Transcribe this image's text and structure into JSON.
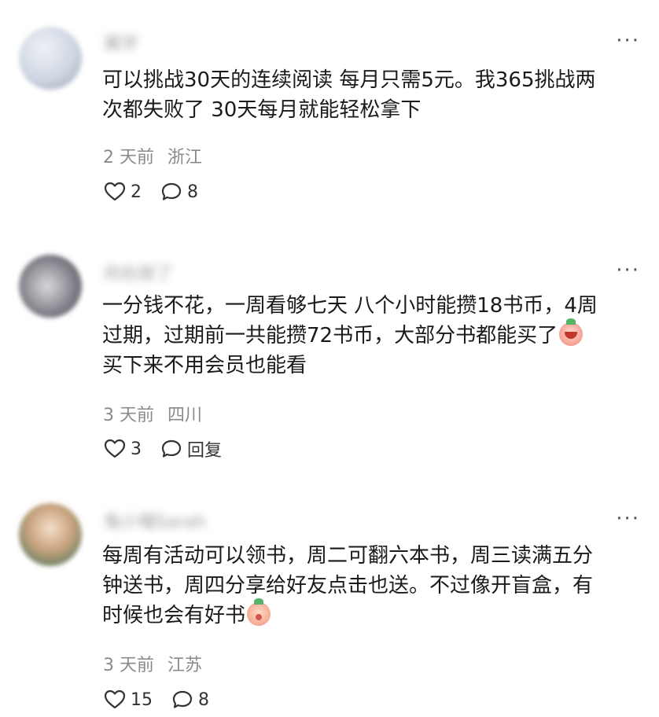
{
  "comments": [
    {
      "username": "离宇",
      "text": "可以挑战30天的连续阅读 每月只需5元。我365挑战两\n次都失败了 30天每月就能轻松拿下",
      "emoji": "",
      "time": "2 天前",
      "location": "浙江",
      "likes": "2",
      "reply_label": "8"
    },
    {
      "username": "向右就了",
      "text": "一分钱不花，一周看够七天 八个小时能攒18书币，4周\n过期，过期前一共能攒72书币，大部分书都能买了",
      "text_after": "买下来不用会员也能看",
      "emoji": "crying-face",
      "time": "3 天前",
      "location": "四川",
      "likes": "3",
      "reply_label": "回复"
    },
    {
      "username": "兔小喵Sarah",
      "text": "每周有活动可以领书，周二可翻六本书，周三读满五分\n钟送书，周四分享给好友点击也送。不过像开盲盒，有\n时候也会有好书",
      "emoji": "sly-face",
      "time": "3 天前",
      "location": "江苏",
      "likes": "15",
      "reply_label": "8"
    }
  ],
  "more_label": "···"
}
